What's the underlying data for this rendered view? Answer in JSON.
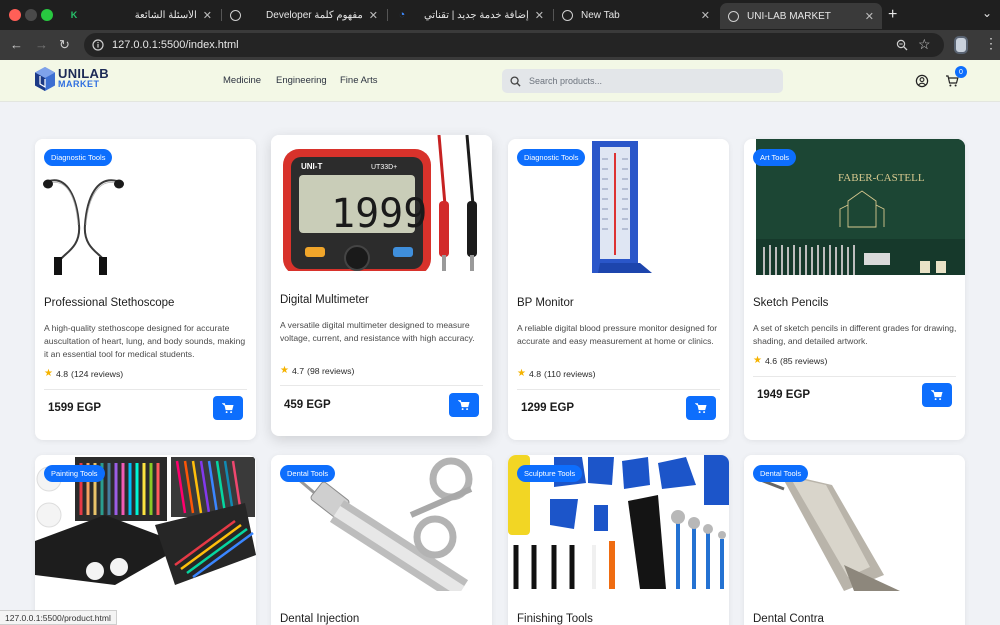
{
  "browser": {
    "tabs": [
      {
        "label": "الأسئلة الشائعة",
        "active": false
      },
      {
        "label": "Developer مفهوم كلمة",
        "active": false
      },
      {
        "label": "إضافة خدمة جديد | تقناتي",
        "active": false
      },
      {
        "label": "New Tab",
        "active": false
      },
      {
        "label": "UNI-LAB MARKET",
        "active": true
      }
    ],
    "url": "127.0.0.1:5500/index.html",
    "status_url": "127.0.0.1:5500/product.html",
    "icons": [
      "back-arrow",
      "forward-arrow",
      "reload",
      "site-info",
      "zoom",
      "bookmark-star",
      "extension",
      "menu"
    ]
  },
  "header": {
    "logo_main": "UNILAB",
    "logo_sub": "MARKET",
    "nav": [
      "Medicine",
      "Engineering",
      "Fine Arts"
    ],
    "search_placeholder": "Search products...",
    "cart_count": "0",
    "accent_color": "#0d6efd",
    "header_bg": "#f3f8e6"
  },
  "products": [
    {
      "badge": "Diagnostic Tools",
      "title": "Professional Stethoscope",
      "description": "A high-quality stethoscope designed for accurate auscultation of heart, lung, and body sounds, making it an essential tool for medical students.",
      "rating": "4.8",
      "reviews": "(124 reviews)",
      "price": "1599 EGP",
      "image": "stethoscope"
    },
    {
      "badge": "",
      "title": "Digital Multimeter",
      "description": "A versatile digital multimeter designed to measure voltage, current, and resistance with high accuracy.",
      "rating": "4.7",
      "reviews": "(98 reviews)",
      "price": "459 EGP",
      "image": "multimeter",
      "image_text": {
        "brand": "UNI-T",
        "model": "UT33D+",
        "display": "1999"
      }
    },
    {
      "badge": "Diagnostic Tools",
      "title": "BP Monitor",
      "description": "A reliable digital blood pressure monitor designed for accurate and easy measurement at home or clinics.",
      "rating": "4.8",
      "reviews": "(110 reviews)",
      "price": "1299 EGP",
      "image": "bp-monitor"
    },
    {
      "badge": "Art Tools",
      "title": "Sketch Pencils",
      "description": "A set of sketch pencils in different grades for drawing, shading, and detailed artwork.",
      "rating": "4.6",
      "reviews": "(85 reviews)",
      "price": "1949 EGP",
      "image": "sketch-pencils",
      "image_text": {
        "brand": "FABER-CASTELL"
      }
    },
    {
      "badge": "Painting Tools",
      "title": "",
      "image": "painting-set"
    },
    {
      "badge": "Dental Tools",
      "title": "Dental Injection",
      "image": "dental-syringe"
    },
    {
      "badge": "Sculpture Tools",
      "title": "Finishing Tools",
      "image": "sculpture-tools"
    },
    {
      "badge": "Dental Tools",
      "title": "Dental Contra",
      "image": "dental-contra"
    }
  ]
}
